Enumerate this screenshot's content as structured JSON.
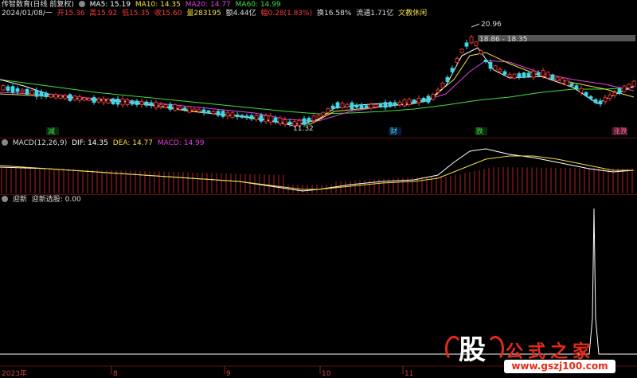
{
  "header": {
    "title": "传智数育(日线 前复权)",
    "ma": [
      {
        "label": "MA5: 15.19",
        "color": "#ffffff"
      },
      {
        "label": "MA10: 14.35",
        "color": "#f0e040"
      },
      {
        "label": "MA20: 14.77",
        "color": "#e040e0"
      },
      {
        "label": "MA60: 14.99",
        "color": "#40e040"
      }
    ]
  },
  "quote": {
    "date": "2024/01/08/一",
    "open": "开15.36",
    "high": "高15.92",
    "low": "低15.35",
    "close": "收15.60",
    "volume": "量283195",
    "amount": "额4.44亿",
    "change": "幅0.28(1.83%)",
    "turnover": "换16.58%",
    "float": "流通1.71亿",
    "concept": "文教休闲"
  },
  "annotations": {
    "high": "20.96",
    "range": "18.86 - 18.35",
    "low": "11.32"
  },
  "markers": [
    "减",
    "财",
    "跌",
    "涨跌"
  ],
  "macd": {
    "title": "MACD(12,26,9)",
    "dif": "DIF: 14.35",
    "dea": "DEA: 14.77",
    "macd": "MACD: 14.99"
  },
  "yingxin": {
    "title": "迎新",
    "label": "迎新选股: 0.00"
  },
  "xaxis": [
    "2023年",
    "8",
    "9",
    "10",
    "11"
  ],
  "brand": {
    "name": "公式之家",
    "url": "www.gszj100.com",
    "logo": "股"
  },
  "colors": {
    "up": "#ff3a3a",
    "down": "#40d8e8",
    "ma5": "#ffffff",
    "ma10": "#f0e040",
    "ma20": "#e040e0",
    "ma60": "#40e040"
  }
}
